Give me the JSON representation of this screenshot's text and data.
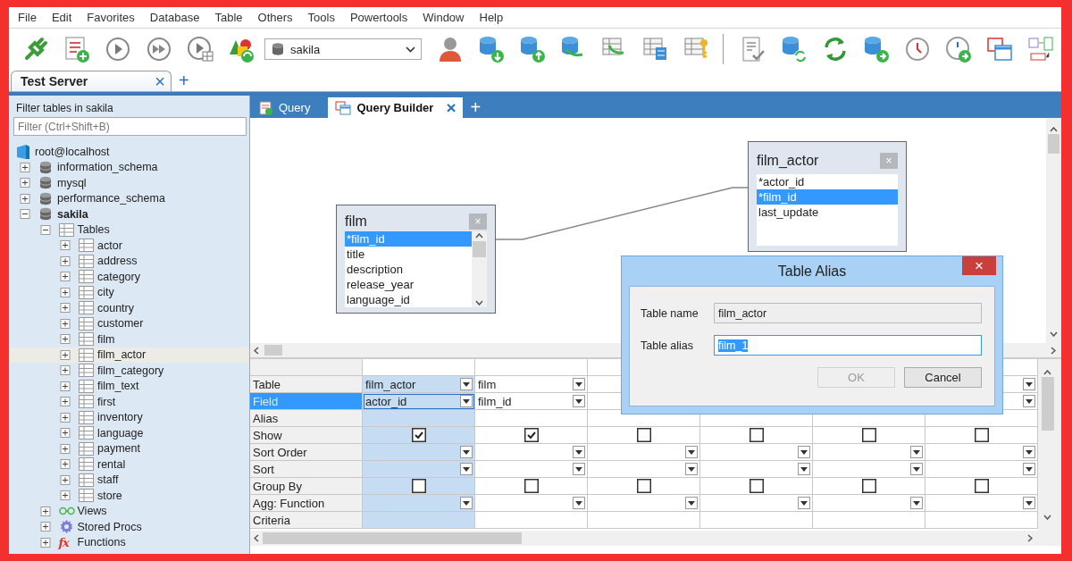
{
  "menu": [
    "File",
    "Edit",
    "Favorites",
    "Database",
    "Table",
    "Others",
    "Tools",
    "Powertools",
    "Window",
    "Help"
  ],
  "toolbar": {
    "database_selector": {
      "value": "sakila"
    }
  },
  "server_tabs": {
    "tabs": [
      {
        "label": "Test Server",
        "selected": true,
        "close": "×"
      }
    ],
    "new_tab": "+"
  },
  "sidebar": {
    "title": "Filter tables in sakila",
    "filter": {
      "placeholder": "Filter (Ctrl+Shift+B)"
    },
    "tree": [
      {
        "label": "root@localhost",
        "kind": "server",
        "selected": false,
        "children": [
          {
            "label": "information_schema",
            "kind": "database",
            "active": false,
            "expanded": false,
            "selected": false
          },
          {
            "label": "mysql",
            "kind": "database",
            "active": false,
            "expanded": false,
            "selected": false
          },
          {
            "label": "performance_schema",
            "kind": "database",
            "active": false,
            "expanded": false,
            "selected": false
          },
          {
            "label": "sakila",
            "kind": "database",
            "active": true,
            "expanded": true,
            "selected": false,
            "children": [
              {
                "label": "Tables",
                "kind": "tables",
                "expanded": true,
                "selected": false,
                "children": [
                  {
                    "label": "actor",
                    "kind": "table",
                    "expanded": false,
                    "selected": false
                  },
                  {
                    "label": "address",
                    "kind": "table",
                    "expanded": false,
                    "selected": false
                  },
                  {
                    "label": "category",
                    "kind": "table",
                    "expanded": false,
                    "selected": false
                  },
                  {
                    "label": "city",
                    "kind": "table",
                    "expanded": false,
                    "selected": false
                  },
                  {
                    "label": "country",
                    "kind": "table",
                    "expanded": false,
                    "selected": false
                  },
                  {
                    "label": "customer",
                    "kind": "table",
                    "expanded": false,
                    "selected": false
                  },
                  {
                    "label": "film",
                    "kind": "table",
                    "expanded": false,
                    "selected": false
                  },
                  {
                    "label": "film_actor",
                    "kind": "table",
                    "expanded": false,
                    "selected": true
                  },
                  {
                    "label": "film_category",
                    "kind": "table",
                    "expanded": false,
                    "selected": false
                  },
                  {
                    "label": "film_text",
                    "kind": "table",
                    "expanded": false,
                    "selected": false
                  },
                  {
                    "label": "first",
                    "kind": "table",
                    "expanded": false,
                    "selected": false
                  },
                  {
                    "label": "inventory",
                    "kind": "table",
                    "expanded": false,
                    "selected": false
                  },
                  {
                    "label": "language",
                    "kind": "table",
                    "expanded": false,
                    "selected": false
                  },
                  {
                    "label": "payment",
                    "kind": "table",
                    "expanded": false,
                    "selected": false
                  },
                  {
                    "label": "rental",
                    "kind": "table",
                    "expanded": false,
                    "selected": false
                  },
                  {
                    "label": "staff",
                    "kind": "table",
                    "expanded": false,
                    "selected": false
                  },
                  {
                    "label": "store",
                    "kind": "table",
                    "expanded": false,
                    "selected": false
                  }
                ]
              },
              {
                "label": "Views",
                "kind": "views",
                "expanded": false,
                "selected": false
              },
              {
                "label": "Stored Procs",
                "kind": "procs",
                "expanded": false,
                "selected": false
              },
              {
                "label": "Functions",
                "kind": "functions",
                "icon_text": "fx",
                "expanded": false,
                "selected": false
              }
            ]
          }
        ]
      }
    ]
  },
  "editor_tabs": {
    "tabs": [
      {
        "label": "Query",
        "selected": false
      },
      {
        "label": "Query Builder",
        "selected": true,
        "close": "×"
      }
    ],
    "new_tab": "+"
  },
  "canvas": {
    "tables": [
      {
        "title": "film",
        "close": "×",
        "scrollable": true,
        "fields": [
          {
            "name": "*film_id",
            "selected": true
          },
          {
            "name": "title",
            "selected": false
          },
          {
            "name": "description",
            "selected": false
          },
          {
            "name": "release_year",
            "selected": false
          },
          {
            "name": "language_id",
            "selected": false
          }
        ]
      },
      {
        "title": "film_actor",
        "close": "×",
        "scrollable": false,
        "fields": [
          {
            "name": "*actor_id",
            "selected": false
          },
          {
            "name": "*film_id",
            "selected": true
          },
          {
            "name": "last_update",
            "selected": false
          }
        ]
      }
    ]
  },
  "grid": {
    "row_labels": [
      {
        "label": "Table",
        "selected": false
      },
      {
        "label": "Field",
        "selected": true
      },
      {
        "label": "Alias",
        "selected": false
      },
      {
        "label": "Show",
        "selected": false
      },
      {
        "label": "Sort Order",
        "selected": false
      },
      {
        "label": "Sort",
        "selected": false
      },
      {
        "label": "Group By",
        "selected": false
      },
      {
        "label": "Agg: Function",
        "selected": false
      },
      {
        "label": "Criteria",
        "selected": false
      }
    ],
    "columns": [
      {
        "selected": true,
        "table": "film_actor",
        "field": "actor_id",
        "show": true,
        "group_by": false
      },
      {
        "selected": false,
        "table": "film",
        "field": "film_id",
        "show": true,
        "group_by": false
      },
      {
        "selected": false,
        "show": false,
        "group_by": false
      },
      {
        "selected": false,
        "show": false,
        "group_by": false
      },
      {
        "selected": false,
        "show": false,
        "group_by": false
      },
      {
        "selected": false,
        "show": false,
        "group_by": false
      }
    ]
  },
  "dialog": {
    "title": "Table Alias",
    "close": "×",
    "fields": [
      {
        "label": "Table name",
        "value": "film_actor",
        "readonly": true,
        "text_selected": false
      },
      {
        "label": "Table alias",
        "value": "film_1",
        "readonly": false,
        "text_selected": true
      }
    ],
    "buttons": [
      {
        "label": "OK",
        "disabled": true
      },
      {
        "label": "Cancel",
        "disabled": false
      }
    ]
  }
}
